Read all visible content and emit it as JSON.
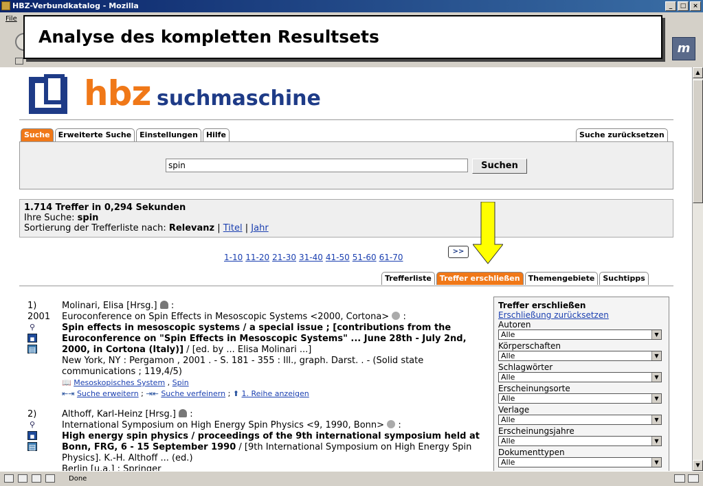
{
  "window": {
    "title": "HBZ-Verbundkatalog - Mozilla",
    "menu_fragment": "File",
    "status": "Done"
  },
  "overlay": {
    "text": "Analyse des kompletten Resultsets"
  },
  "logo": {
    "brand": "hbz",
    "subtitle": "suchmaschine"
  },
  "tabs": {
    "items": [
      "Suche",
      "Erweiterte Suche",
      "Einstellungen",
      "Hilfe"
    ],
    "reset": "Suche zurücksetzen"
  },
  "search": {
    "value": "spin",
    "button": "Suchen"
  },
  "info": {
    "count_line": "1.714 Treffer in 0,294 Sekunden",
    "query_label": "Ihre Suche: ",
    "query_value": "spin",
    "sort_label": "Sortierung der Trefferliste nach: ",
    "sort_active": "Relevanz",
    "sort_sep": " | ",
    "sort_opt1": "Titel",
    "sort_opt2": "Jahr"
  },
  "pager": {
    "pages": [
      "1-10",
      "11-20",
      "21-30",
      "31-40",
      "41-50",
      "51-60",
      "61-70"
    ],
    "next": ">>"
  },
  "result_tabs": {
    "items": [
      "Trefferliste",
      "Treffer erschließen",
      "Themengebiete",
      "Suchtipps"
    ],
    "active_index": 1
  },
  "results": [
    {
      "num": "1)",
      "year": "2001",
      "author": "Molinari, Elisa [Hrsg.]",
      "corp": "Euroconference on Spin Effects in Mesoscopic Systems <2000, Cortona>",
      "title": "Spin effects in mesoscopic systems / a special issue ; [contributions from the Euroconference on \"Spin Effects in Mesoscopic Systems\" ... June 28th - July 2nd, 2000, in Cortona (Italy)]",
      "resp": " / [ed. by ... Elisa Molinari ...]",
      "pub": "New York, NY : Pergamon , 2001 . - S. 181 - 355 : Ill., graph. Darst. . - (Solid state communications ; 119,4/5)",
      "subj1": "Mesoskopisches System",
      "subj_sep": " , ",
      "subj2": "Spin",
      "act1": "Suche erweitern",
      "act2": "Suche verfeinern",
      "act3": "1. Reihe anzeigen",
      "act_sep": " ; "
    },
    {
      "num": "2)",
      "author": "Althoff, Karl-Heinz [Hrsg.]",
      "corp": "International Symposium on High Energy Spin Physics <9, 1990, Bonn>",
      "title": "High energy spin physics / proceedings of the 9th international symposium held at Bonn, FRG, 6 - 15 September 1990",
      "resp": " / [9th International Symposium on High Energy Spin Physics]. K.-H. Althoff ... (ed.)",
      "pub": "Berlin [u.a.] : Springer"
    }
  ],
  "sidebar": {
    "heading": "Treffer erschließen",
    "reset_link": "Erschließung zurücksetzen",
    "facets": [
      {
        "label": "Autoren",
        "value": "Alle"
      },
      {
        "label": "Körperschaften",
        "value": "Alle"
      },
      {
        "label": "Schlagwörter",
        "value": "Alle"
      },
      {
        "label": "Erscheinungsorte",
        "value": "Alle"
      },
      {
        "label": "Verlage",
        "value": "Alle"
      },
      {
        "label": "Erscheinungsjahre",
        "value": "Alle"
      },
      {
        "label": "Dokumenttypen",
        "value": "Alle"
      }
    ]
  },
  "colors": {
    "accent": "#f07818",
    "brand_blue": "#1e3b87",
    "arrow": "#ffff00"
  }
}
